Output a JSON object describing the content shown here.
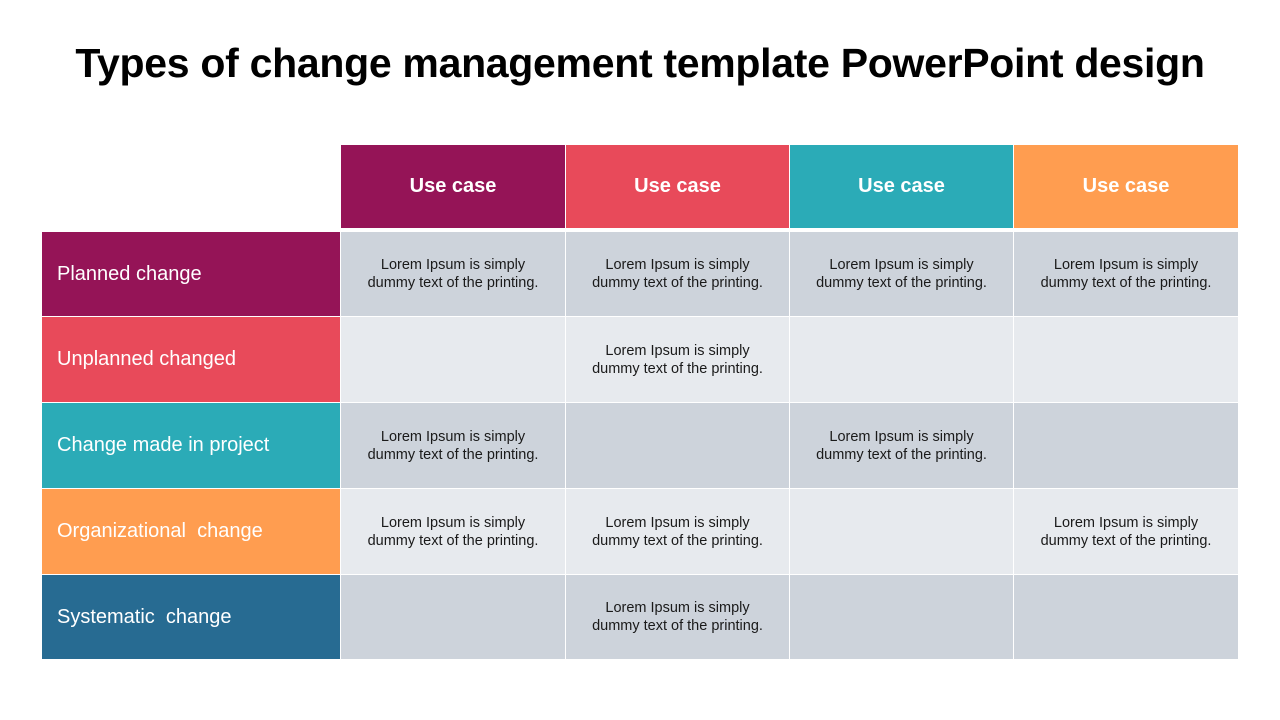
{
  "title": "Types of change management template PowerPoint design",
  "colors": {
    "purple": "#951457",
    "red": "#e84a5a",
    "teal": "#2babb7",
    "orange": "#ff9d50",
    "blue": "#276b92",
    "cell_dark": "#cdd3db",
    "cell_light": "#e7eaee"
  },
  "headers": [
    "Use case",
    "Use case",
    "Use case",
    "Use case"
  ],
  "rows": [
    {
      "label": "Planned change",
      "cells": [
        "Lorem Ipsum is simply\ndummy text of the printing.",
        "Lorem Ipsum is simply\ndummy text of the printing.",
        "Lorem Ipsum is simply\ndummy text of the printing.",
        "Lorem Ipsum is simply\ndummy text of the printing."
      ]
    },
    {
      "label": "Unplanned changed",
      "cells": [
        "",
        "Lorem Ipsum is simply\ndummy text of the printing.",
        "",
        ""
      ]
    },
    {
      "label": "Change made in project",
      "cells": [
        "Lorem Ipsum is simply\ndummy text of the printing.",
        "",
        "Lorem Ipsum is simply\ndummy text of the printing.",
        ""
      ]
    },
    {
      "label": "Organizational  change",
      "cells": [
        "Lorem Ipsum is simply\ndummy text of the printing.",
        "Lorem Ipsum is simply\ndummy text of the printing.",
        "",
        "Lorem Ipsum is simply\ndummy text of the printing."
      ]
    },
    {
      "label": "Systematic  change",
      "cells": [
        "",
        "Lorem Ipsum is simply\ndummy text of the printing.",
        "",
        ""
      ]
    }
  ]
}
